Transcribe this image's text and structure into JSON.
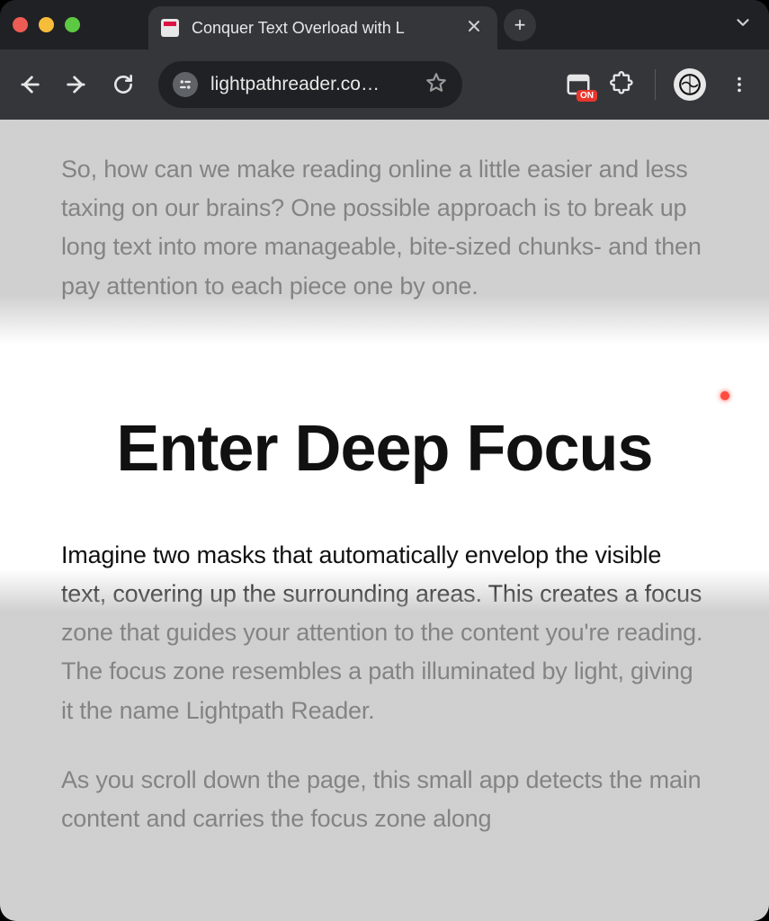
{
  "window": {
    "tab_title": "Conquer Text Overload with L",
    "new_tab_label": "+"
  },
  "toolbar": {
    "url_display": "lightpathreader.co…",
    "extension_badge": "ON"
  },
  "article": {
    "para1": "So, how can we make reading online a little easier and less taxing on our brains? One possible approach is to break up long text into more manageable, bite-sized chunks- and then pay attention to each piece one by one.",
    "heading": "Enter Deep Focus",
    "para2": "Imagine two masks that automatically envelop the visible text, covering up the surrounding areas. This creates a focus zone that guides your attention to the content you're reading. The focus zone resembles a path illuminated by light, giving it the name Lightpath Reader.",
    "para3": "As you scroll down the page, this small app detects the main content and carries the focus zone along"
  }
}
